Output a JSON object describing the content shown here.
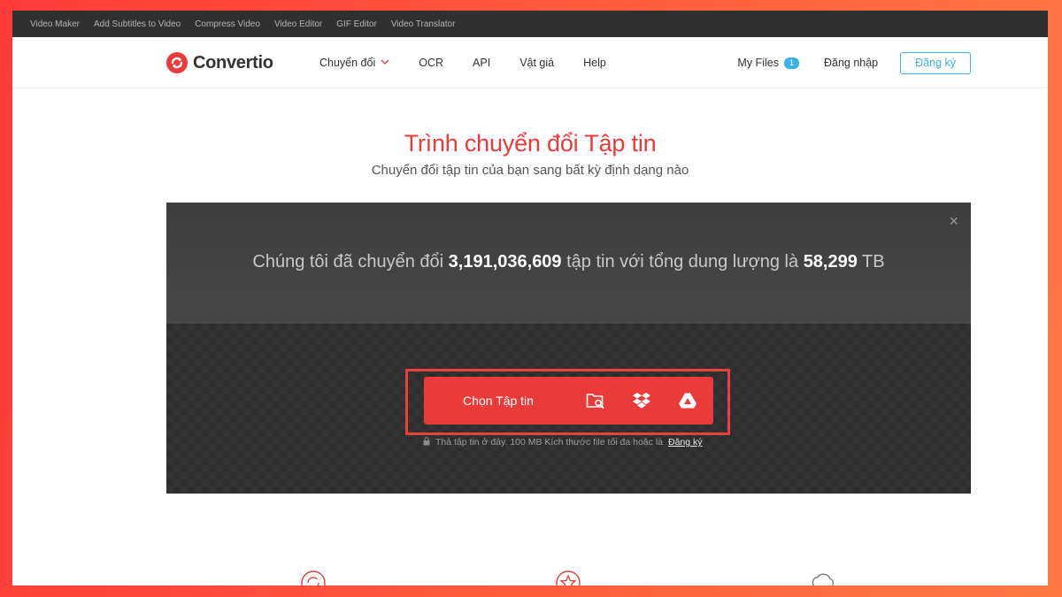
{
  "topbar": {
    "links": [
      "Video Maker",
      "Add Subtitles to Video",
      "Compress Video",
      "Video Editor",
      "GIF Editor",
      "Video Translator"
    ]
  },
  "header": {
    "logo_text": "Convertio",
    "nav": [
      {
        "label": "Chuyển đổi",
        "has_dropdown": true
      },
      {
        "label": "OCR"
      },
      {
        "label": "API"
      },
      {
        "label": "Vật giá"
      },
      {
        "label": "Help"
      }
    ],
    "my_files_label": "My Files",
    "my_files_count": "1",
    "login_label": "Đăng nhập",
    "signup_label": "Đăng ký"
  },
  "hero": {
    "title": "Trình chuyển đổi Tập tin",
    "subtitle": "Chuyển đổi tập tin của bạn sang bất kỳ định dạng nào"
  },
  "panel": {
    "close_symbol": "×",
    "stats_prefix": "Chúng tôi đã chuyển đổi ",
    "files_converted": "3,191,036,609",
    "stats_middle": " tập tin với tổng dung lượng là ",
    "total_size": "58,299",
    "stats_unit": " TB",
    "choose_file_label": "Chọn Tập tin",
    "sources": [
      "folder-search-icon",
      "dropbox-icon",
      "google-drive-icon"
    ],
    "drop_hint": "Thả tập tin ở đây. 100 MB Kích thước file tối đa hoặc là",
    "drop_hint_link": "Đăng ký"
  },
  "colors": {
    "brand": "#ea3a3a",
    "accent_blue": "#3bb2e6",
    "highlight_border": "#e8413b",
    "topbar_bg": "#303030",
    "panel_bg": "#2c2c2c"
  },
  "features": [
    "refresh-icon",
    "star-icon",
    "cloud-icon"
  ]
}
